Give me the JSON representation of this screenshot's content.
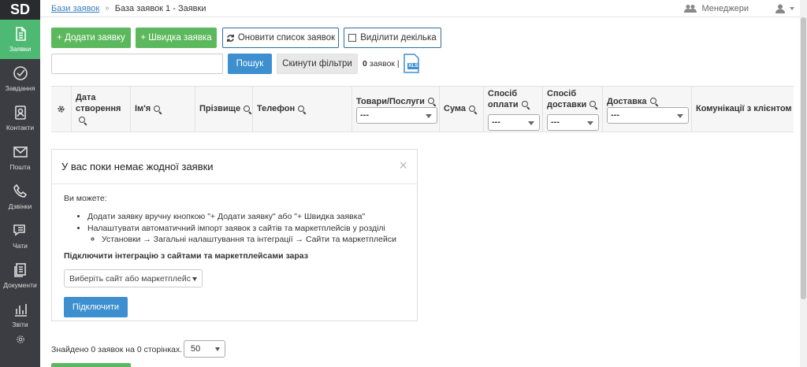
{
  "app": {
    "logo": "SD"
  },
  "sidebar": {
    "items": [
      {
        "label": "Заявки",
        "icon": "document-icon"
      },
      {
        "label": "Завдання",
        "icon": "check-circle-icon"
      },
      {
        "label": "Контакти",
        "icon": "contact-card-icon"
      },
      {
        "label": "Пошта",
        "icon": "envelope-icon"
      },
      {
        "label": "Дзвінки",
        "icon": "phone-icon"
      },
      {
        "label": "Чати",
        "icon": "chat-icon"
      },
      {
        "label": "Документи",
        "icon": "documents-icon"
      },
      {
        "label": "Звіти",
        "icon": "bar-chart-icon"
      }
    ]
  },
  "breadcrumb": {
    "link": "Бази заявок",
    "separator": "»",
    "current": "База заявок 1 - Заявки"
  },
  "topbar": {
    "managers_label": "Менеджери"
  },
  "toolbar": {
    "add_label": "+ Додати заявку",
    "quick_label": "+ Швидка заявка",
    "refresh_label": "Оновити список заявок",
    "select_many_label": "Виділити декілька",
    "search_value": "",
    "search_button": "Пошук",
    "reset_button": "Скинути фільтри",
    "count_number": "0",
    "count_suffix": "заявок |",
    "xls_label": "XLS"
  },
  "table": {
    "columns": {
      "date_line1": "Дата",
      "date_line2": "створення",
      "name": "Ім'я",
      "surname": "Прізвище",
      "phone": "Телефон",
      "goods": "Товари/Послуги",
      "sum": "Сума",
      "payment_line1": "Спосіб",
      "payment_line2": "оплати",
      "shipping_line1": "Спосіб",
      "shipping_line2": "доставки",
      "delivery": "Доставка",
      "communications": "Комунікації з клієнтом"
    },
    "filter_default": "---"
  },
  "empty_panel": {
    "title": "У вас поки немає жодної заявки",
    "close": "×",
    "intro": "Ви можете:",
    "bullet1": "Додати заявку вручну кнопкою \"+ Додати заявку\" або \"+ Швидка заявка\"",
    "bullet2": "Налаштувати автоматичний імпорт заявок з сайтів та маркетплейсів у розділі",
    "sub_bullet": "Установки → Загальні налаштування та інтеграції → Сайти та маркетплейси",
    "connect_heading": "Підключити інтеграцію з сайтами та маркетплейсами зараз",
    "select_placeholder": "Виберіть сайт або маркетплейс",
    "connect_button": "Підключити"
  },
  "footer": {
    "found_text": "Знайдено 0 заявок на 0 сторінках.",
    "page_size": "50"
  },
  "colors": {
    "sidebar_bg": "#3c3d42",
    "active_green": "#4eb972",
    "button_green": "#5cb85c",
    "button_blue": "#3d8fd0"
  }
}
